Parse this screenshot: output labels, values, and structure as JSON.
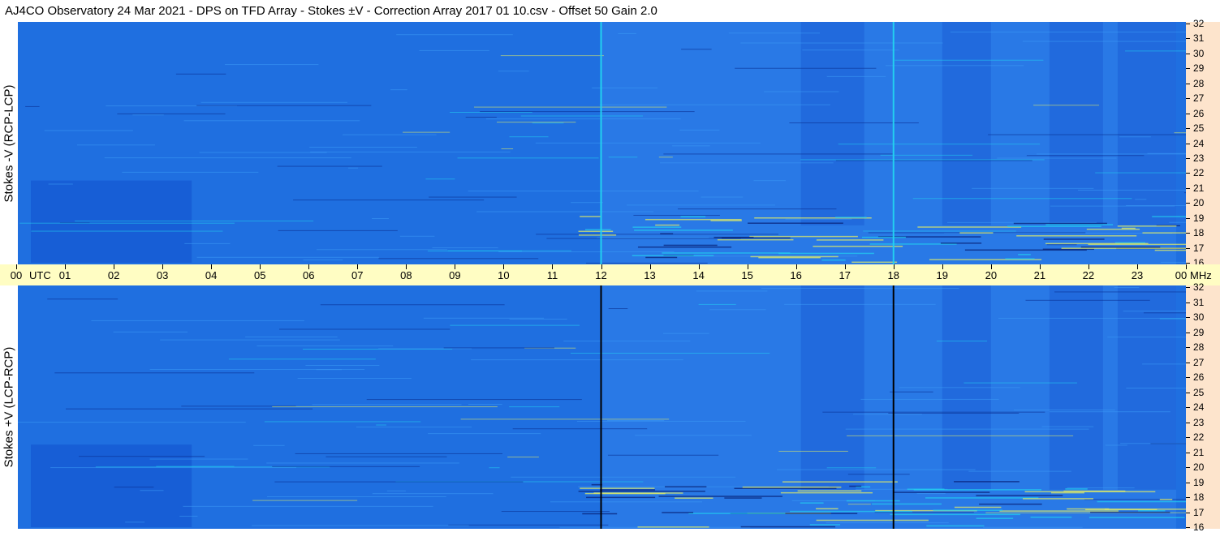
{
  "title": "AJ4CO Observatory  24 Mar 2021  -  DPS on TFD Array  -  Stokes ±V  -  Correction Array 2017 01 10.csv  -  Offset 50  Gain 2.0",
  "time_unit": "UTC",
  "freq_unit": "MHz",
  "colors": {
    "background_blue": "#1f6fe0",
    "deep_blue": "#0a3fc4",
    "cyan_streak": "#22d0f0",
    "yellow_streak": "#e8f060",
    "time_axis_bg": "#fffdc3",
    "freq_axis_bg": "#fde4cc"
  },
  "chart_data": {
    "type": "heatmap",
    "x": {
      "label": "UTC",
      "range": [
        0,
        24
      ],
      "ticks": [
        "00",
        "01",
        "02",
        "03",
        "04",
        "05",
        "06",
        "07",
        "08",
        "09",
        "10",
        "11",
        "12",
        "13",
        "14",
        "15",
        "16",
        "17",
        "18",
        "19",
        "20",
        "21",
        "22",
        "23",
        "00"
      ]
    },
    "y": {
      "label": "MHz",
      "range": [
        16,
        32
      ],
      "ticks": [
        16,
        17,
        18,
        19,
        20,
        21,
        22,
        23,
        24,
        25,
        26,
        27,
        28,
        29,
        30,
        31,
        32
      ]
    },
    "panels": [
      {
        "name": "Stokes -V (RCP-LCP)",
        "vertical_lines": [
          {
            "utc": 12,
            "color": "#22d0f0"
          },
          {
            "utc": 18,
            "color": "#22d0f0"
          }
        ]
      },
      {
        "name": "Stokes +V (LCP-RCP)",
        "vertical_lines": [
          {
            "utc": 12,
            "color": "#000000"
          },
          {
            "utc": 18,
            "color": "#000000"
          }
        ]
      }
    ]
  }
}
